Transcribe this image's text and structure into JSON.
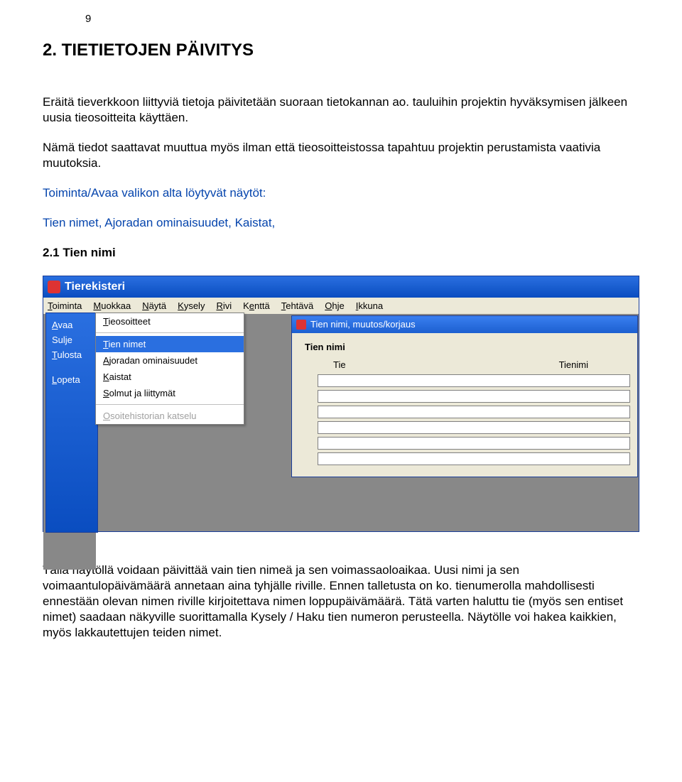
{
  "pageNumber": "9",
  "heading": "2. TIETIETOJEN PÄIVITYS",
  "para1": "Eräitä tieverkkoon liittyviä tietoja päivitetään suoraan tietokannan ao. tauluihin projektin hyväksymisen jälkeen uusia tieosoitteita käyttäen.",
  "para2": "Nämä tiedot saattavat muuttua myös ilman että tieosoitteistossa tapahtuu projektin perustamista vaativia muutoksia.",
  "para3": "Toiminta/Avaa valikon alta löytyvät näytöt:",
  "para4": "Tien nimet,  Ajoradan ominaisuudet, Kaistat,",
  "subheading": "2.1 Tien nimi",
  "para5": "Tällä näytöllä voidaan päivittää vain tien nimeä ja sen voimassaoloaikaa. Uusi nimi ja sen voimaantulopäivämäärä annetaan aina tyhjälle riville. Ennen talletusta on ko. tienumerolla mahdollisesti ennestään olevan nimen riville kirjoitettava nimen loppupäivämäärä. Tätä varten haluttu tie (myös sen entiset nimet) saadaan näkyville suorittamalla Kysely / Haku tien numeron perusteella. Näytölle voi hakea kaikkien, myös lakkautettujen teiden nimet.",
  "ui": {
    "appTitle": "Tierekisteri",
    "menubar": [
      "Toiminta",
      "Muokkaa",
      "Näytä",
      "Kysely",
      "Rivi",
      "Kenttä",
      "Tehtävä",
      "Ohje",
      "Ikkuna"
    ],
    "dropdown": [
      "Avaa",
      "Sulje",
      "Tulosta",
      "Lopeta"
    ],
    "submenu": {
      "item1": "Tieosoitteet",
      "item2": "Tien nimet",
      "item3": "Ajoradan ominaisuudet",
      "item4": "Kaistat",
      "item5": "Solmut ja liittymät",
      "item6": "Osoitehistorian katselu"
    },
    "childWindow": {
      "title": "Tien nimi, muutos/korjaus",
      "groupLabel": "Tien nimi",
      "fieldTie": "Tie",
      "fieldTienimi": "Tienimi"
    }
  }
}
